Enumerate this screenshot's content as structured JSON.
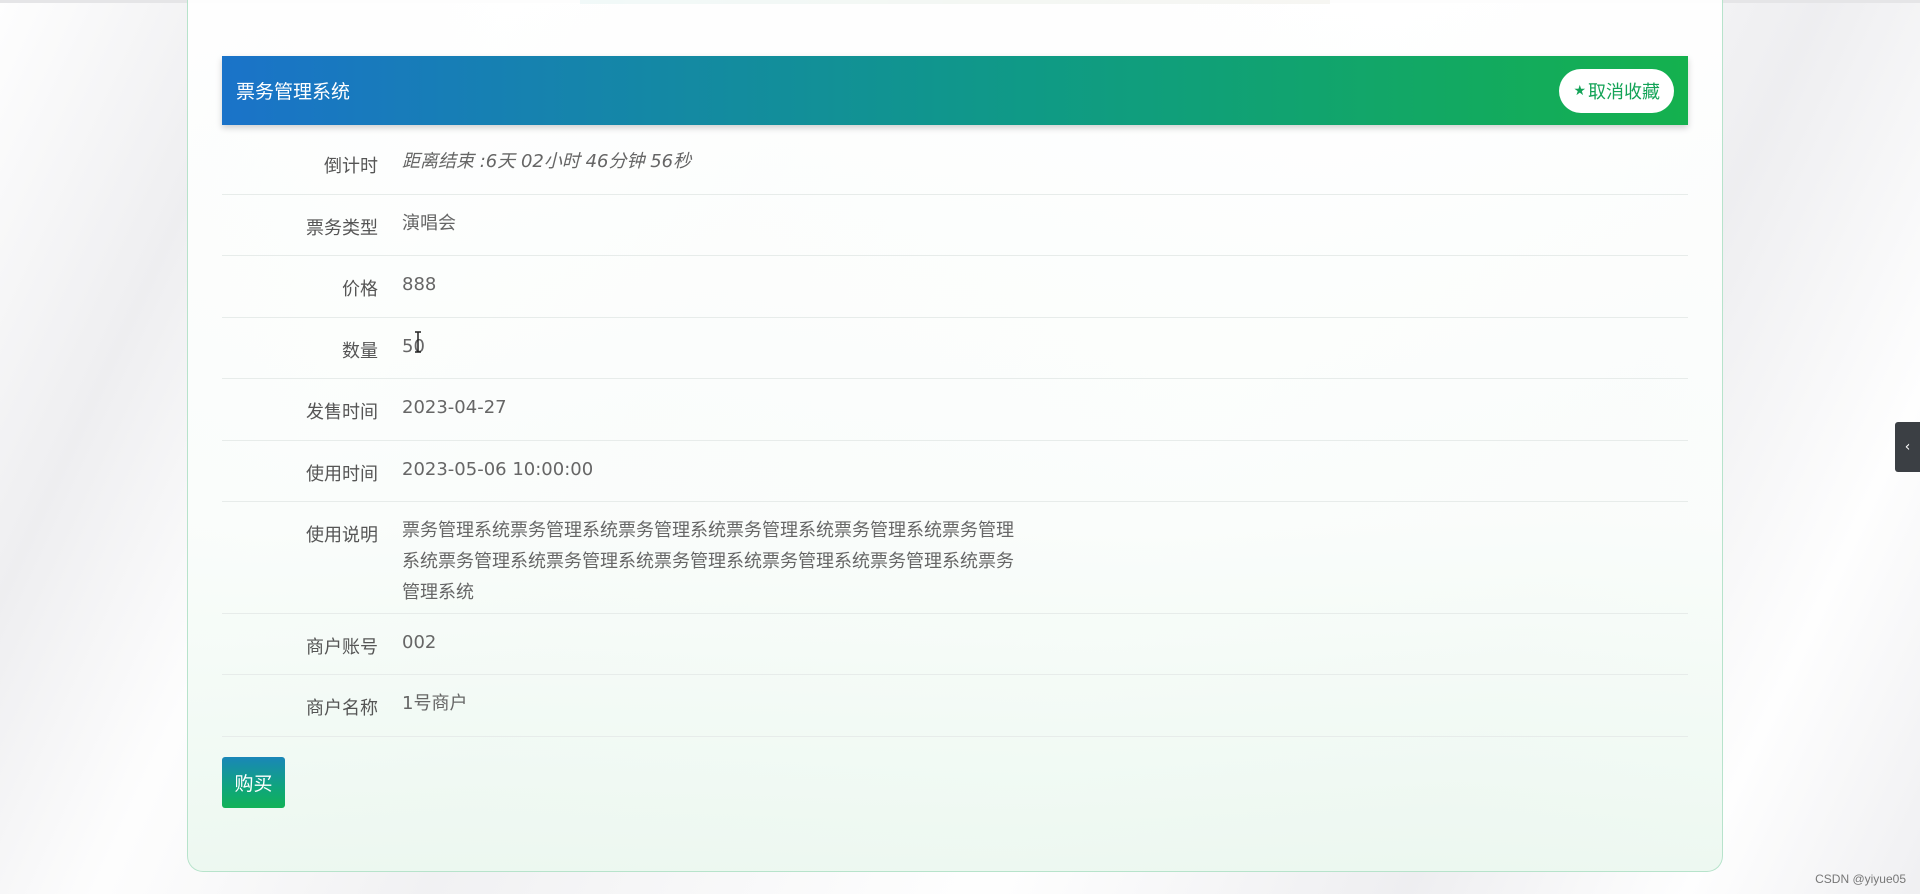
{
  "header": {
    "title": "票务管理系统",
    "favorite_button_label": "取消收藏",
    "favorite_icon": "star-icon"
  },
  "details": [
    {
      "label": "倒计时",
      "value": "距离结束 :6天 02小时 46分钟 56秒"
    },
    {
      "label": "票务类型",
      "value": "演唱会"
    },
    {
      "label": "价格",
      "value": "888"
    },
    {
      "label": "数量",
      "value": "50"
    },
    {
      "label": "发售时间",
      "value": "2023-04-27"
    },
    {
      "label": "使用时间",
      "value": "2023-05-06 10:00:00"
    },
    {
      "label": "使用说明",
      "value": "票务管理系统票务管理系统票务管理系统票务管理系统票务管理系统票务管理系统票务管理系统票务管理系统票务管理系统票务管理系统票务管理系统票务管理系统"
    },
    {
      "label": "商户账号",
      "value": "002"
    },
    {
      "label": "商户名称",
      "value": "1号商户"
    }
  ],
  "actions": {
    "buy_label": "购买"
  },
  "side_toggle": {
    "icon": "chevron-left-icon",
    "glyph": "‹"
  },
  "watermark": "CSDN @yiyue05",
  "colors": {
    "header_gradient_start": "#1a73c9",
    "header_gradient_end": "#14b14e",
    "accent_green": "#13a357"
  }
}
